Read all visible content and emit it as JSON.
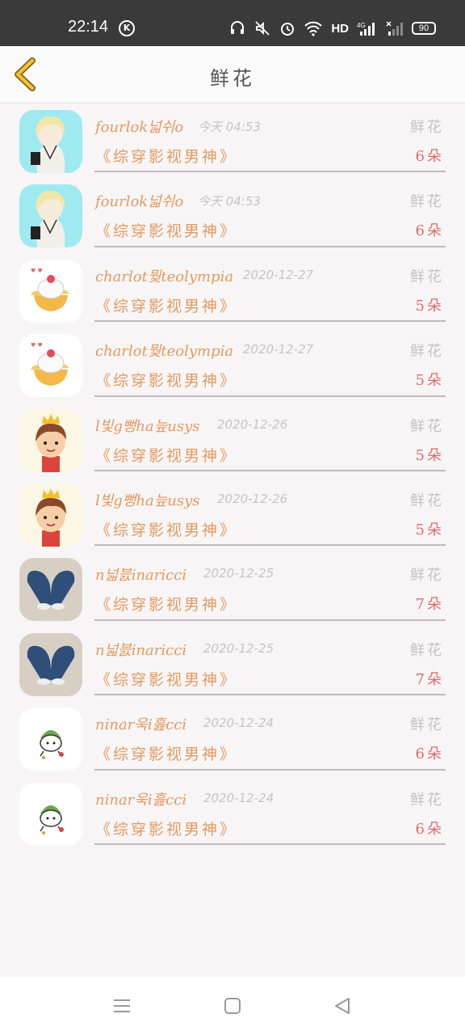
{
  "status": {
    "time": "22:14",
    "hd": "HD",
    "network": "4G",
    "battery": "90"
  },
  "header": {
    "title": "鲜花"
  },
  "items": [
    {
      "name": "fourlok넓쉬o",
      "date": "今天 04:53",
      "gift": "鲜花",
      "title": "《综穿影视男神》",
      "count": "6朵",
      "avatar": "blond-boy"
    },
    {
      "name": "fourlok넓쉬o",
      "date": "今天 04:53",
      "gift": "鲜花",
      "title": "《综穿影视男神》",
      "count": "6朵",
      "avatar": "blond-boy"
    },
    {
      "name": "charlot뭦teolympia",
      "date": "2020-12-27",
      "gift": "鲜花",
      "title": "《综穿影视男神》",
      "count": "5朵",
      "avatar": "cake"
    },
    {
      "name": "charlot뭦teolympia",
      "date": "2020-12-27",
      "gift": "鲜花",
      "title": "《综穿影视男神》",
      "count": "5朵",
      "avatar": "cake"
    },
    {
      "name": "l빛g뻥ha늪usys",
      "date": "2020-12-26",
      "gift": "鲜花",
      "title": "《综穿影视男神》",
      "count": "5朵",
      "avatar": "crown-boy"
    },
    {
      "name": "l빛g뻥ha늪usys",
      "date": "2020-12-26",
      "gift": "鲜花",
      "title": "《综穿影视男神》",
      "count": "5朵",
      "avatar": "crown-boy"
    },
    {
      "name": "n넓븘inaricci",
      "date": "2020-12-25",
      "gift": "鲜花",
      "title": "《综穿影视男神》",
      "count": "7朵",
      "avatar": "shoes"
    },
    {
      "name": "n넓븘inaricci",
      "date": "2020-12-25",
      "gift": "鲜花",
      "title": "《综穿影视男神》",
      "count": "7朵",
      "avatar": "shoes"
    },
    {
      "name": "ninar욱i흞cci",
      "date": "2020-12-24",
      "gift": "鲜花",
      "title": "《综穿影视男神》",
      "count": "6朵",
      "avatar": "riceball"
    },
    {
      "name": "ninar욱i흞cci",
      "date": "2020-12-24",
      "gift": "鲜花",
      "title": "《综穿影视男神》",
      "count": "6朵",
      "avatar": "riceball"
    }
  ],
  "nav": {
    "menu_icon": "menu-icon",
    "home_icon": "home-square-icon",
    "back_icon": "back-triangle-icon"
  }
}
